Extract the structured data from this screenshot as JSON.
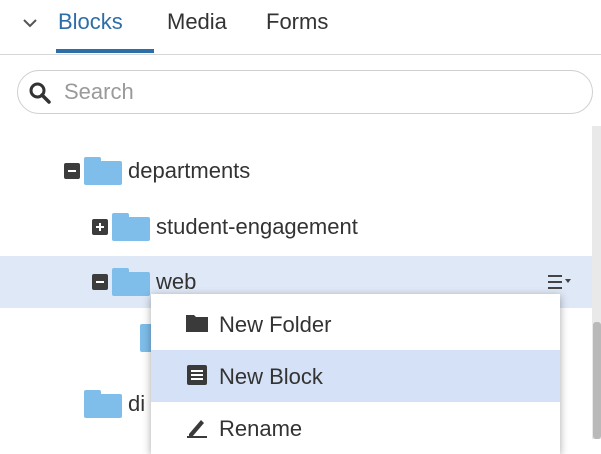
{
  "tabs": {
    "items": [
      {
        "label": "Blocks",
        "active": true
      },
      {
        "label": "Media",
        "active": false
      },
      {
        "label": "Forms",
        "active": false
      }
    ]
  },
  "search": {
    "placeholder": "Search",
    "value": ""
  },
  "tree": {
    "items": [
      {
        "label": "departments",
        "state": "expanded",
        "selected": false
      },
      {
        "label": "student-engagement",
        "state": "collapsed",
        "selected": false
      },
      {
        "label": "web",
        "state": "expanded",
        "selected": true
      },
      {
        "label": "",
        "state": "leaf",
        "selected": false
      },
      {
        "label": "di",
        "state": "none",
        "selected": false
      }
    ]
  },
  "context_menu": {
    "items": [
      {
        "label": "New Folder",
        "icon": "folder-icon"
      },
      {
        "label": "New Block",
        "icon": "block-icon",
        "highlighted": true
      },
      {
        "label": "Rename",
        "icon": "rename-icon"
      }
    ]
  },
  "colors": {
    "accent": "#2e6ea8",
    "folder": "#7fbdea",
    "selected_row": "#dfe8f6",
    "menu_highlight": "#d5e1f6"
  }
}
